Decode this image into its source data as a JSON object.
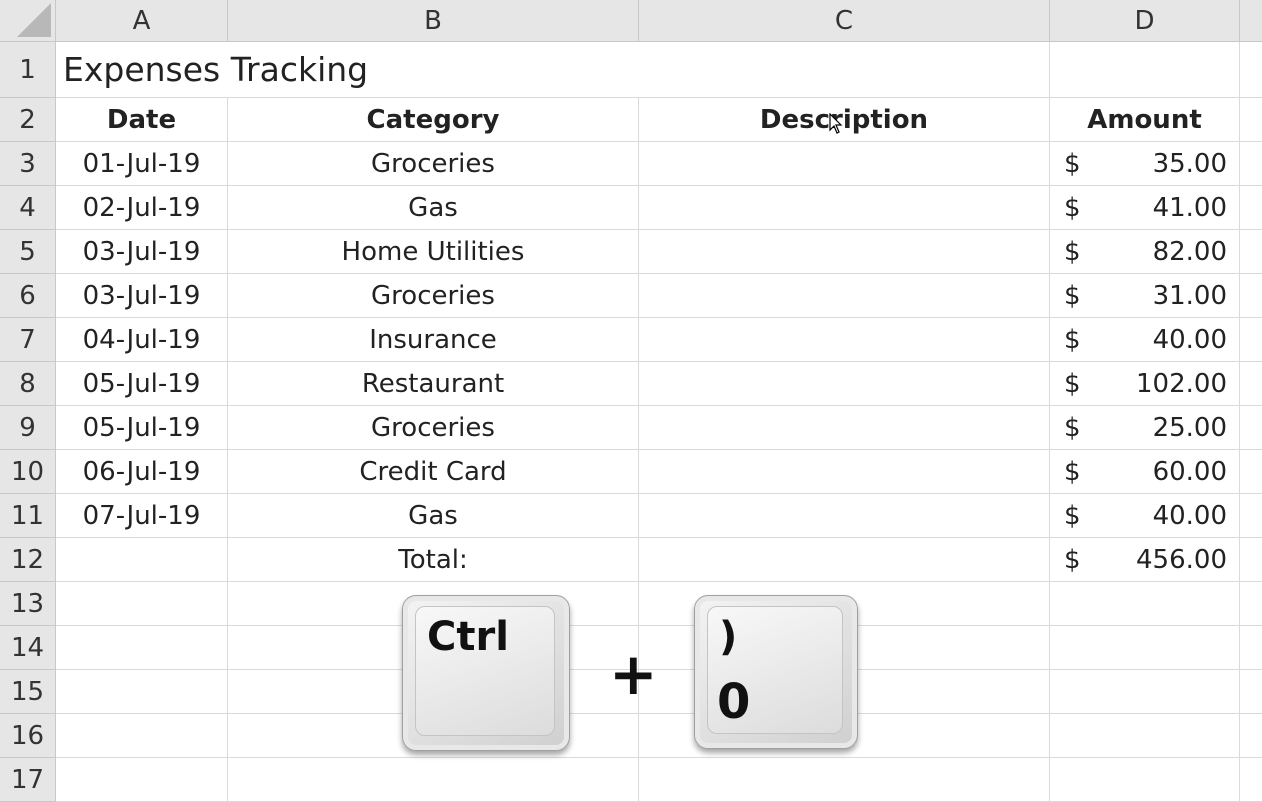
{
  "columns": [
    "A",
    "B",
    "C",
    "D"
  ],
  "rows": [
    "1",
    "2",
    "3",
    "4",
    "5",
    "6",
    "7",
    "8",
    "9",
    "10",
    "11",
    "12",
    "13",
    "14",
    "15",
    "16",
    "17"
  ],
  "title": "Expenses Tracking",
  "headers": {
    "date": "Date",
    "category": "Category",
    "description": "Description",
    "amount": "Amount"
  },
  "currency_symbol": "$",
  "entries": [
    {
      "date": "01-Jul-19",
      "category": "Groceries",
      "amount": "35.00"
    },
    {
      "date": "02-Jul-19",
      "category": "Gas",
      "amount": "41.00"
    },
    {
      "date": "03-Jul-19",
      "category": "Home Utilities",
      "amount": "82.00"
    },
    {
      "date": "03-Jul-19",
      "category": "Groceries",
      "amount": "31.00"
    },
    {
      "date": "04-Jul-19",
      "category": "Insurance",
      "amount": "40.00"
    },
    {
      "date": "05-Jul-19",
      "category": "Restaurant",
      "amount": "102.00"
    },
    {
      "date": "05-Jul-19",
      "category": "Groceries",
      "amount": "25.00"
    },
    {
      "date": "06-Jul-19",
      "category": "Credit Card",
      "amount": "60.00"
    },
    {
      "date": "07-Jul-19",
      "category": "Gas",
      "amount": "40.00"
    }
  ],
  "total": {
    "label": "Total:",
    "amount": "456.00"
  },
  "shortcut": {
    "key1": "Ctrl",
    "plus": "+",
    "key2_top": ")",
    "key2_bottom": "0"
  }
}
